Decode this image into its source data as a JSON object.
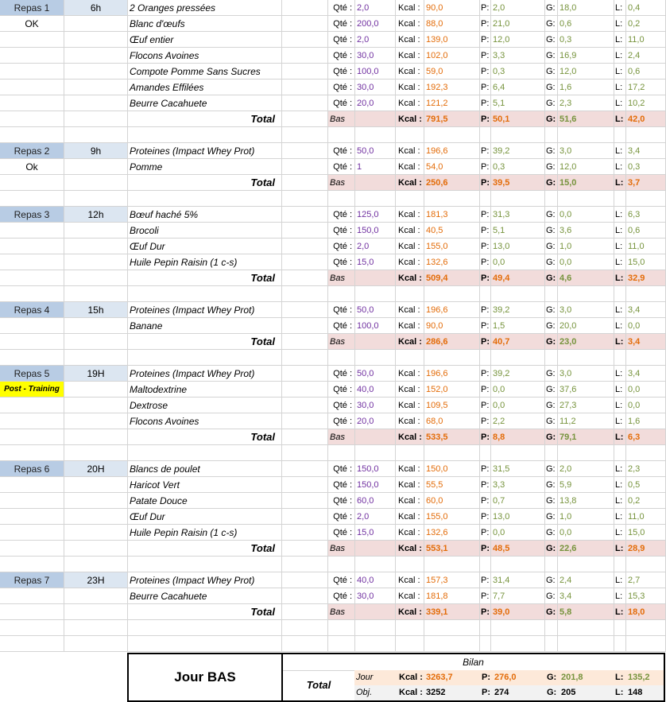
{
  "labels": {
    "qte": "Qté :",
    "kcal": "Kcal :",
    "p": "P:",
    "g": "G:",
    "l": "L:",
    "total": "Total",
    "bas": "Bas"
  },
  "meals": [
    {
      "name": "Repas 1",
      "time": "6h",
      "status": "OK",
      "items": [
        {
          "food": "2 Oranges pressées",
          "qte": "2,0",
          "kcal": "90,0",
          "p": "2,0",
          "g": "18,0",
          "l": "0,4"
        },
        {
          "food": "Blanc d'œufs",
          "qte": "200,0",
          "kcal": "88,0",
          "p": "21,0",
          "g": "0,6",
          "l": "0,2"
        },
        {
          "food": "Œuf entier",
          "qte": "2,0",
          "kcal": "139,0",
          "p": "12,0",
          "g": "0,3",
          "l": "11,0"
        },
        {
          "food": "Flocons Avoines",
          "qte": "30,0",
          "kcal": "102,0",
          "p": "3,3",
          "g": "16,9",
          "l": "2,4"
        },
        {
          "food": "Compote Pomme Sans Sucres",
          "qte": "100,0",
          "kcal": "59,0",
          "p": "0,3",
          "g": "12,0",
          "l": "0,6"
        },
        {
          "food": "Amandes Effilées",
          "qte": "30,0",
          "kcal": "192,3",
          "p": "6,4",
          "g": "1,6",
          "l": "17,2"
        },
        {
          "food": "Beurre Cacahuete",
          "qte": "20,0",
          "kcal": "121,2",
          "p": "5,1",
          "g": "2,3",
          "l": "10,2"
        }
      ],
      "total": {
        "kcal": "791,5",
        "p": "50,1",
        "g": "51,6",
        "l": "42,0"
      }
    },
    {
      "name": "Repas 2",
      "time": "9h",
      "status": "Ok",
      "items": [
        {
          "food": "Proteines (Impact Whey Prot)",
          "qte": "50,0",
          "kcal": "196,6",
          "p": "39,2",
          "g": "3,0",
          "l": "3,4"
        },
        {
          "food": "Pomme",
          "qte": "1",
          "kcal": "54,0",
          "p": "0,3",
          "g": "12,0",
          "l": "0,3"
        }
      ],
      "total": {
        "kcal": "250,6",
        "p": "39,5",
        "g": "15,0",
        "l": "3,7"
      }
    },
    {
      "name": "Repas 3",
      "time": "12h",
      "status": "",
      "items": [
        {
          "food": "Bœuf haché 5%",
          "qte": "125,0",
          "kcal": "181,3",
          "p": "31,3",
          "g": "0,0",
          "l": "6,3"
        },
        {
          "food": "Brocoli",
          "qte": "150,0",
          "kcal": "40,5",
          "p": "5,1",
          "g": "3,6",
          "l": "0,6"
        },
        {
          "food": "Œuf Dur",
          "qte": "2,0",
          "kcal": "155,0",
          "p": "13,0",
          "g": "1,0",
          "l": "11,0"
        },
        {
          "food": "Huile Pepin Raisin (1 c-s)",
          "qte": "15,0",
          "kcal": "132,6",
          "p": "0,0",
          "g": "0,0",
          "l": "15,0"
        }
      ],
      "total": {
        "kcal": "509,4",
        "p": "49,4",
        "g": "4,6",
        "l": "32,9"
      }
    },
    {
      "name": "Repas 4",
      "time": "15h",
      "status": "",
      "items": [
        {
          "food": "Proteines (Impact Whey Prot)",
          "qte": "50,0",
          "kcal": "196,6",
          "p": "39,2",
          "g": "3,0",
          "l": "3,4"
        },
        {
          "food": "Banane",
          "qte": "100,0",
          "kcal": "90,0",
          "p": "1,5",
          "g": "20,0",
          "l": "0,0"
        }
      ],
      "total": {
        "kcal": "286,6",
        "p": "40,7",
        "g": "23,0",
        "l": "3,4"
      }
    },
    {
      "name": "Repas 5",
      "time": "19H",
      "status": "Post - Training",
      "items": [
        {
          "food": "Proteines (Impact Whey Prot)",
          "qte": "50,0",
          "kcal": "196,6",
          "p": "39,2",
          "g": "3,0",
          "l": "3,4"
        },
        {
          "food": "Maltodextrine",
          "qte": "40,0",
          "kcal": "152,0",
          "p": "0,0",
          "g": "37,6",
          "l": "0,0"
        },
        {
          "food": "Dextrose",
          "qte": "30,0",
          "kcal": "109,5",
          "p": "0,0",
          "g": "27,3",
          "l": "0,0"
        },
        {
          "food": "Flocons Avoines",
          "qte": "20,0",
          "kcal": "68,0",
          "p": "2,2",
          "g": "11,2",
          "l": "1,6"
        }
      ],
      "total": {
        "kcal": "533,5",
        "p": "8,8",
        "g": "79,1",
        "l": "6,3"
      }
    },
    {
      "name": "Repas 6",
      "time": "20H",
      "status": "",
      "items": [
        {
          "food": "Blancs de poulet",
          "qte": "150,0",
          "kcal": "150,0",
          "p": "31,5",
          "g": "2,0",
          "l": "2,3"
        },
        {
          "food": "Haricot Vert",
          "qte": "150,0",
          "kcal": "55,5",
          "p": "3,3",
          "g": "5,9",
          "l": "0,5"
        },
        {
          "food": "Patate Douce",
          "qte": "60,0",
          "kcal": "60,0",
          "p": "0,7",
          "g": "13,8",
          "l": "0,2"
        },
        {
          "food": "Œuf Dur",
          "qte": "2,0",
          "kcal": "155,0",
          "p": "13,0",
          "g": "1,0",
          "l": "11,0"
        },
        {
          "food": "Huile Pepin Raisin (1 c-s)",
          "qte": "15,0",
          "kcal": "132,6",
          "p": "0,0",
          "g": "0,0",
          "l": "15,0"
        }
      ],
      "total": {
        "kcal": "553,1",
        "p": "48,5",
        "g": "22,6",
        "l": "28,9"
      }
    },
    {
      "name": "Repas 7",
      "time": "23H",
      "status": "",
      "items": [
        {
          "food": "Proteines (Impact Whey Prot)",
          "qte": "40,0",
          "kcal": "157,3",
          "p": "31,4",
          "g": "2,4",
          "l": "2,7"
        },
        {
          "food": "Beurre Cacahuete",
          "qte": "30,0",
          "kcal": "181,8",
          "p": "7,7",
          "g": "3,4",
          "l": "15,3"
        }
      ],
      "total": {
        "kcal": "339,1",
        "p": "39,0",
        "g": "5,8",
        "l": "18,0"
      }
    }
  ],
  "summary": {
    "day_label": "Jour BAS",
    "bilan_title": "Bilan",
    "total_label": "Total",
    "jour": {
      "label": "Jour",
      "kcal": "3263,7",
      "p": "276,0",
      "g": "201,8",
      "l": "135,2"
    },
    "obj": {
      "label": "Obj.",
      "kcal": "3252",
      "p": "274",
      "g": "205",
      "l": "148"
    }
  },
  "colors": {
    "repas_bg": "#b8cce4",
    "hour_bg": "#dce6f1",
    "total_bg": "#f2dcdb",
    "post_training_bg": "#ffff00",
    "kcal_color": "#e36c09",
    "macro_color": "#76933c",
    "qte_color": "#7030a0"
  }
}
